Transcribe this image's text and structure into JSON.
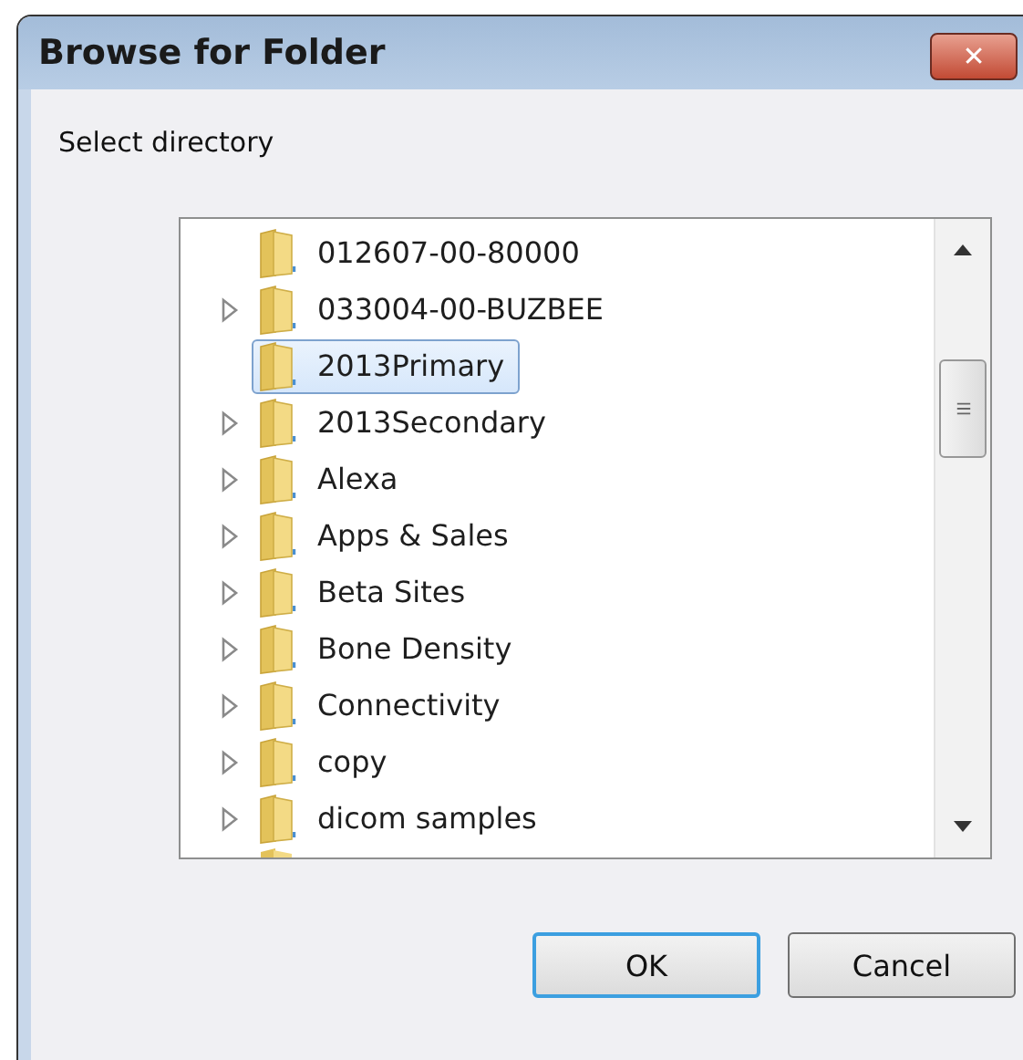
{
  "window": {
    "title": "Browse for Folder",
    "close": "✕"
  },
  "prompt": "Select directory",
  "tree": [
    {
      "label": "012607-00-80000",
      "has_children": false,
      "selected": false
    },
    {
      "label": "033004-00-BUZBEE",
      "has_children": true,
      "selected": false
    },
    {
      "label": "2013Primary",
      "has_children": false,
      "selected": true
    },
    {
      "label": "2013Secondary",
      "has_children": true,
      "selected": false
    },
    {
      "label": "Alexa",
      "has_children": true,
      "selected": false
    },
    {
      "label": "Apps & Sales",
      "has_children": true,
      "selected": false
    },
    {
      "label": "Beta Sites",
      "has_children": true,
      "selected": false
    },
    {
      "label": "Bone Density",
      "has_children": true,
      "selected": false
    },
    {
      "label": "Connectivity",
      "has_children": true,
      "selected": false
    },
    {
      "label": "copy",
      "has_children": true,
      "selected": false
    },
    {
      "label": "dicom samples",
      "has_children": true,
      "selected": false
    }
  ],
  "buttons": [
    {
      "label": "OK",
      "default": true
    },
    {
      "label": "Cancel",
      "default": false
    }
  ]
}
